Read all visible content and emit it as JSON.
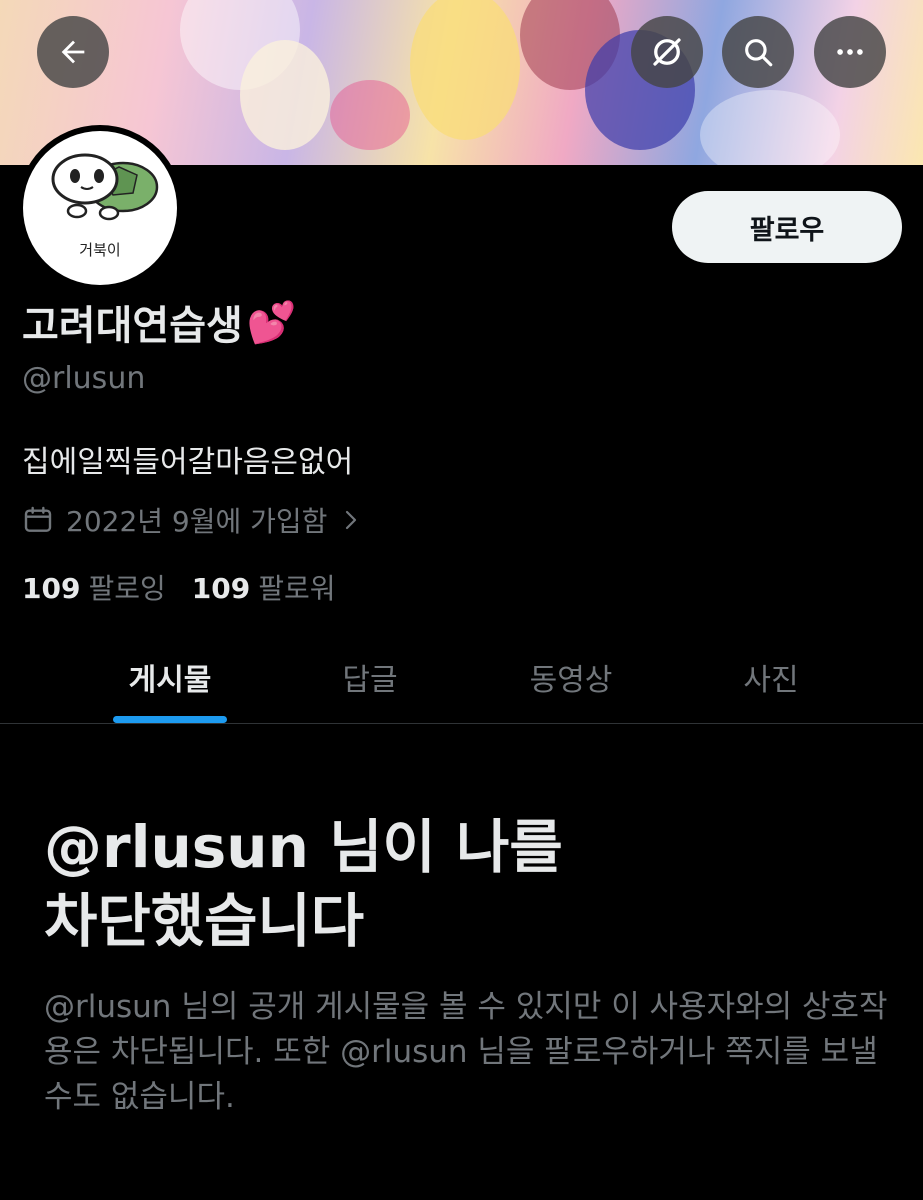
{
  "header": {
    "back_icon": "arrow-left-icon",
    "grok_icon": "slashed-circle-icon",
    "search_icon": "search-icon",
    "more_icon": "more-horizontal-icon"
  },
  "avatar": {
    "caption": "거북이"
  },
  "profile": {
    "follow_label": "팔로우",
    "display_name": "고려대연습생",
    "display_name_emoji": "💕",
    "handle": "@rlusun",
    "bio": "집에일찍들어갈마음은없어",
    "joined": "2022년 9월에 가입함",
    "following_count": "109",
    "following_label": "팔로잉",
    "followers_count": "109",
    "followers_label": "팔로워"
  },
  "tabs": [
    {
      "label": "게시물",
      "active": true
    },
    {
      "label": "답글",
      "active": false
    },
    {
      "label": "동영상",
      "active": false
    },
    {
      "label": "사진",
      "active": false
    }
  ],
  "blocked": {
    "title": "@rlusun 님이 나를 차단했습니다",
    "description": "@rlusun 님의 공개 게시물을 볼 수 있지만 이 사용자와의 상호작용은 차단됩니다. 또한 @rlusun 님을 팔로우하거나 쪽지를 보낼 수도 없습니다."
  },
  "colors": {
    "background": "#000000",
    "primary_text": "#e7e9ea",
    "secondary_text": "#71767b",
    "accent": "#1d9bf0",
    "follow_button_bg": "#eff3f4"
  }
}
